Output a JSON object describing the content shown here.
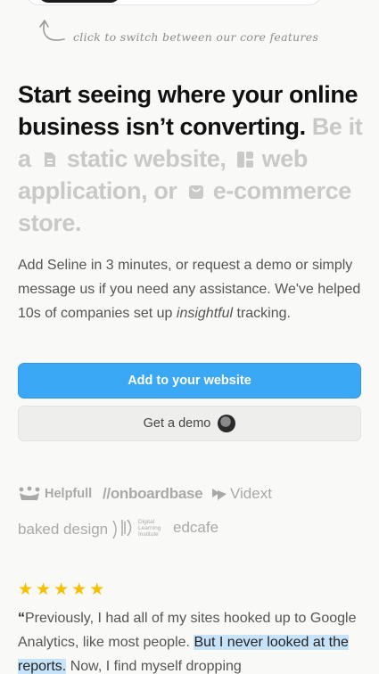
{
  "hint": {
    "text": "click to switch between our core features"
  },
  "headline": {
    "line_strong": "Start seeing where your online business isn’t converting.",
    "be_it": "Be it a",
    "static": "static website,",
    "web": "web application, or",
    "ecom": "e-commerce store."
  },
  "description": {
    "part1": "Add Seline in 3 minutes, or request a demo or simply message us if you need any assistance. We've helped 10s of companies set up",
    "emph": "insightful",
    "part2": "tracking."
  },
  "buttons": {
    "primary": "Add to your website",
    "secondary": "Get a demo"
  },
  "logos": {
    "helpfull": "Helpfull",
    "onboardbase": "//onboardbase",
    "vidext": "Vidext",
    "baked": "baked design",
    "dli_lines": [
      "Digital",
      "Learning",
      "Institute"
    ],
    "edcafe": "edcafe"
  },
  "rating": {
    "stars": 5,
    "star_color": "#f6c000"
  },
  "testimonial": {
    "open": "“",
    "text1": "Previously, I had all of my sites hooked up to Google Analytics, like most people.",
    "highlight": "But I never looked at the reports.",
    "text2": "Now, I find myself dropping"
  },
  "colors": {
    "accent": "#3ba8f5",
    "highlight": "#c6e3fa"
  },
  "icons": [
    "file-icon",
    "layout-icon",
    "shopping-bag-icon",
    "curved-arrow-icon"
  ]
}
